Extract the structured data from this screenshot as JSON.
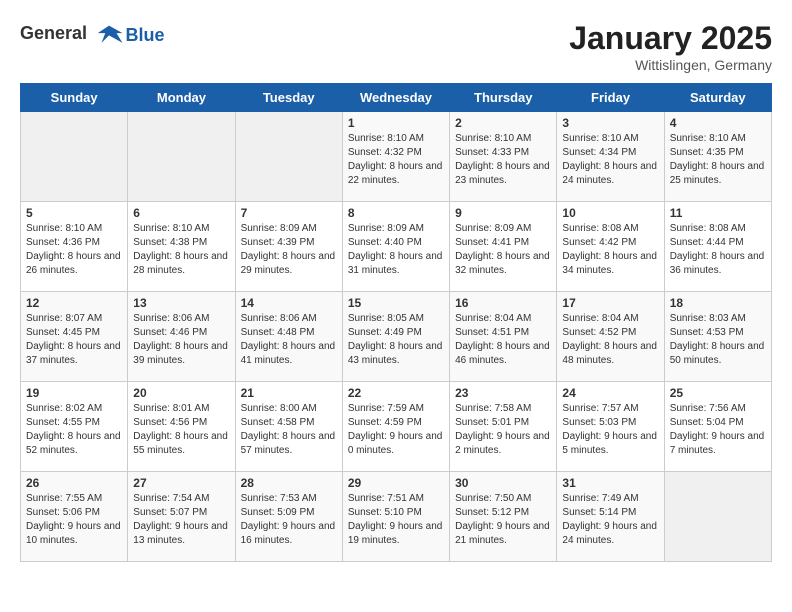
{
  "header": {
    "logo_general": "General",
    "logo_blue": "Blue",
    "month_title": "January 2025",
    "subtitle": "Wittislingen, Germany"
  },
  "days_of_week": [
    "Sunday",
    "Monday",
    "Tuesday",
    "Wednesday",
    "Thursday",
    "Friday",
    "Saturday"
  ],
  "weeks": [
    [
      {
        "day": "",
        "info": ""
      },
      {
        "day": "",
        "info": ""
      },
      {
        "day": "",
        "info": ""
      },
      {
        "day": "1",
        "info": "Sunrise: 8:10 AM\nSunset: 4:32 PM\nDaylight: 8 hours and 22 minutes."
      },
      {
        "day": "2",
        "info": "Sunrise: 8:10 AM\nSunset: 4:33 PM\nDaylight: 8 hours and 23 minutes."
      },
      {
        "day": "3",
        "info": "Sunrise: 8:10 AM\nSunset: 4:34 PM\nDaylight: 8 hours and 24 minutes."
      },
      {
        "day": "4",
        "info": "Sunrise: 8:10 AM\nSunset: 4:35 PM\nDaylight: 8 hours and 25 minutes."
      }
    ],
    [
      {
        "day": "5",
        "info": "Sunrise: 8:10 AM\nSunset: 4:36 PM\nDaylight: 8 hours and 26 minutes."
      },
      {
        "day": "6",
        "info": "Sunrise: 8:10 AM\nSunset: 4:38 PM\nDaylight: 8 hours and 28 minutes."
      },
      {
        "day": "7",
        "info": "Sunrise: 8:09 AM\nSunset: 4:39 PM\nDaylight: 8 hours and 29 minutes."
      },
      {
        "day": "8",
        "info": "Sunrise: 8:09 AM\nSunset: 4:40 PM\nDaylight: 8 hours and 31 minutes."
      },
      {
        "day": "9",
        "info": "Sunrise: 8:09 AM\nSunset: 4:41 PM\nDaylight: 8 hours and 32 minutes."
      },
      {
        "day": "10",
        "info": "Sunrise: 8:08 AM\nSunset: 4:42 PM\nDaylight: 8 hours and 34 minutes."
      },
      {
        "day": "11",
        "info": "Sunrise: 8:08 AM\nSunset: 4:44 PM\nDaylight: 8 hours and 36 minutes."
      }
    ],
    [
      {
        "day": "12",
        "info": "Sunrise: 8:07 AM\nSunset: 4:45 PM\nDaylight: 8 hours and 37 minutes."
      },
      {
        "day": "13",
        "info": "Sunrise: 8:06 AM\nSunset: 4:46 PM\nDaylight: 8 hours and 39 minutes."
      },
      {
        "day": "14",
        "info": "Sunrise: 8:06 AM\nSunset: 4:48 PM\nDaylight: 8 hours and 41 minutes."
      },
      {
        "day": "15",
        "info": "Sunrise: 8:05 AM\nSunset: 4:49 PM\nDaylight: 8 hours and 43 minutes."
      },
      {
        "day": "16",
        "info": "Sunrise: 8:04 AM\nSunset: 4:51 PM\nDaylight: 8 hours and 46 minutes."
      },
      {
        "day": "17",
        "info": "Sunrise: 8:04 AM\nSunset: 4:52 PM\nDaylight: 8 hours and 48 minutes."
      },
      {
        "day": "18",
        "info": "Sunrise: 8:03 AM\nSunset: 4:53 PM\nDaylight: 8 hours and 50 minutes."
      }
    ],
    [
      {
        "day": "19",
        "info": "Sunrise: 8:02 AM\nSunset: 4:55 PM\nDaylight: 8 hours and 52 minutes."
      },
      {
        "day": "20",
        "info": "Sunrise: 8:01 AM\nSunset: 4:56 PM\nDaylight: 8 hours and 55 minutes."
      },
      {
        "day": "21",
        "info": "Sunrise: 8:00 AM\nSunset: 4:58 PM\nDaylight: 8 hours and 57 minutes."
      },
      {
        "day": "22",
        "info": "Sunrise: 7:59 AM\nSunset: 4:59 PM\nDaylight: 9 hours and 0 minutes."
      },
      {
        "day": "23",
        "info": "Sunrise: 7:58 AM\nSunset: 5:01 PM\nDaylight: 9 hours and 2 minutes."
      },
      {
        "day": "24",
        "info": "Sunrise: 7:57 AM\nSunset: 5:03 PM\nDaylight: 9 hours and 5 minutes."
      },
      {
        "day": "25",
        "info": "Sunrise: 7:56 AM\nSunset: 5:04 PM\nDaylight: 9 hours and 7 minutes."
      }
    ],
    [
      {
        "day": "26",
        "info": "Sunrise: 7:55 AM\nSunset: 5:06 PM\nDaylight: 9 hours and 10 minutes."
      },
      {
        "day": "27",
        "info": "Sunrise: 7:54 AM\nSunset: 5:07 PM\nDaylight: 9 hours and 13 minutes."
      },
      {
        "day": "28",
        "info": "Sunrise: 7:53 AM\nSunset: 5:09 PM\nDaylight: 9 hours and 16 minutes."
      },
      {
        "day": "29",
        "info": "Sunrise: 7:51 AM\nSunset: 5:10 PM\nDaylight: 9 hours and 19 minutes."
      },
      {
        "day": "30",
        "info": "Sunrise: 7:50 AM\nSunset: 5:12 PM\nDaylight: 9 hours and 21 minutes."
      },
      {
        "day": "31",
        "info": "Sunrise: 7:49 AM\nSunset: 5:14 PM\nDaylight: 9 hours and 24 minutes."
      },
      {
        "day": "",
        "info": ""
      }
    ]
  ]
}
